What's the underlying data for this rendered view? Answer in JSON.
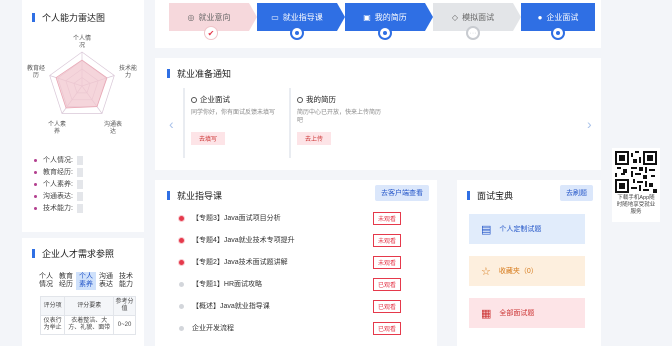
{
  "left": {
    "radar_title": "个人能力雷达图",
    "radar_axes": [
      "个人情况",
      "技术能力",
      "沟通表达",
      "个人素养",
      "教育经历"
    ],
    "abilities": [
      {
        "label": "个人情况:"
      },
      {
        "label": "教育经历:"
      },
      {
        "label": "个人素养:"
      },
      {
        "label": "沟通表达:"
      },
      {
        "label": "技术能力:"
      }
    ],
    "demand_title": "企业人才需求参照",
    "demand_tabs": [
      "个人情况",
      "教育经历",
      "个人素养",
      "沟通表达",
      "技术能力"
    ],
    "demand_active_tab": 2,
    "demand_headers": [
      "评分项",
      "评分要素",
      "参考分值"
    ],
    "demand_rows": [
      {
        "item": "仪表行为举止",
        "factor": "衣着整洁、大方、礼貌、面带",
        "score": "0~20"
      }
    ]
  },
  "steps": [
    {
      "label": "就业意向",
      "style": "pink",
      "mark": "✔"
    },
    {
      "label": "就业指导课",
      "style": "blue",
      "mark": ""
    },
    {
      "label": "我的简历",
      "style": "blue",
      "mark": ""
    },
    {
      "label": "模拟面试",
      "style": "gray",
      "mark": "···"
    },
    {
      "label": "企业面试",
      "style": "blue",
      "mark": ""
    }
  ],
  "notice": {
    "title": "就业准备通知",
    "cards": [
      {
        "title": "企业面试",
        "desc": "同学你好，你有面试反馈未填写",
        "button": "去填写"
      },
      {
        "title": "我的简历",
        "desc": "简历中心已开放，快来上传简历吧",
        "button": "去上传"
      }
    ]
  },
  "guide": {
    "title": "就业指导课",
    "action": "去客户端查看",
    "courses": [
      {
        "title": "【专题3】Java面试项目分析",
        "status": "未观看",
        "dot": "red"
      },
      {
        "title": "【专题4】Java就业技术专项提升",
        "status": "未观看",
        "dot": "red"
      },
      {
        "title": "【专题2】Java技术面试题讲解",
        "status": "未观看",
        "dot": "red"
      },
      {
        "title": "【专题1】HR面试攻略",
        "status": "已观看",
        "dot": "gray"
      },
      {
        "title": "【概述】Java就业指导课",
        "status": "已观看",
        "dot": "gray"
      },
      {
        "title": "企业开发流程",
        "status": "已观看",
        "dot": "gray"
      }
    ]
  },
  "treasure": {
    "title": "面试宝典",
    "action": "去刷题",
    "items": [
      {
        "label": "个人定制试题",
        "style": "blue",
        "icon": "▤"
      },
      {
        "label": "收藏夹（0）",
        "style": "orange",
        "icon": "☆"
      },
      {
        "label": "全部面试题",
        "style": "pink",
        "icon": "▦"
      }
    ]
  },
  "qr": {
    "text": "下载手机App随时随地享受就业服务"
  },
  "colors": {
    "primary": "#2f6fe4",
    "danger": "#e5394b",
    "accent_purple": "#b3408f"
  }
}
